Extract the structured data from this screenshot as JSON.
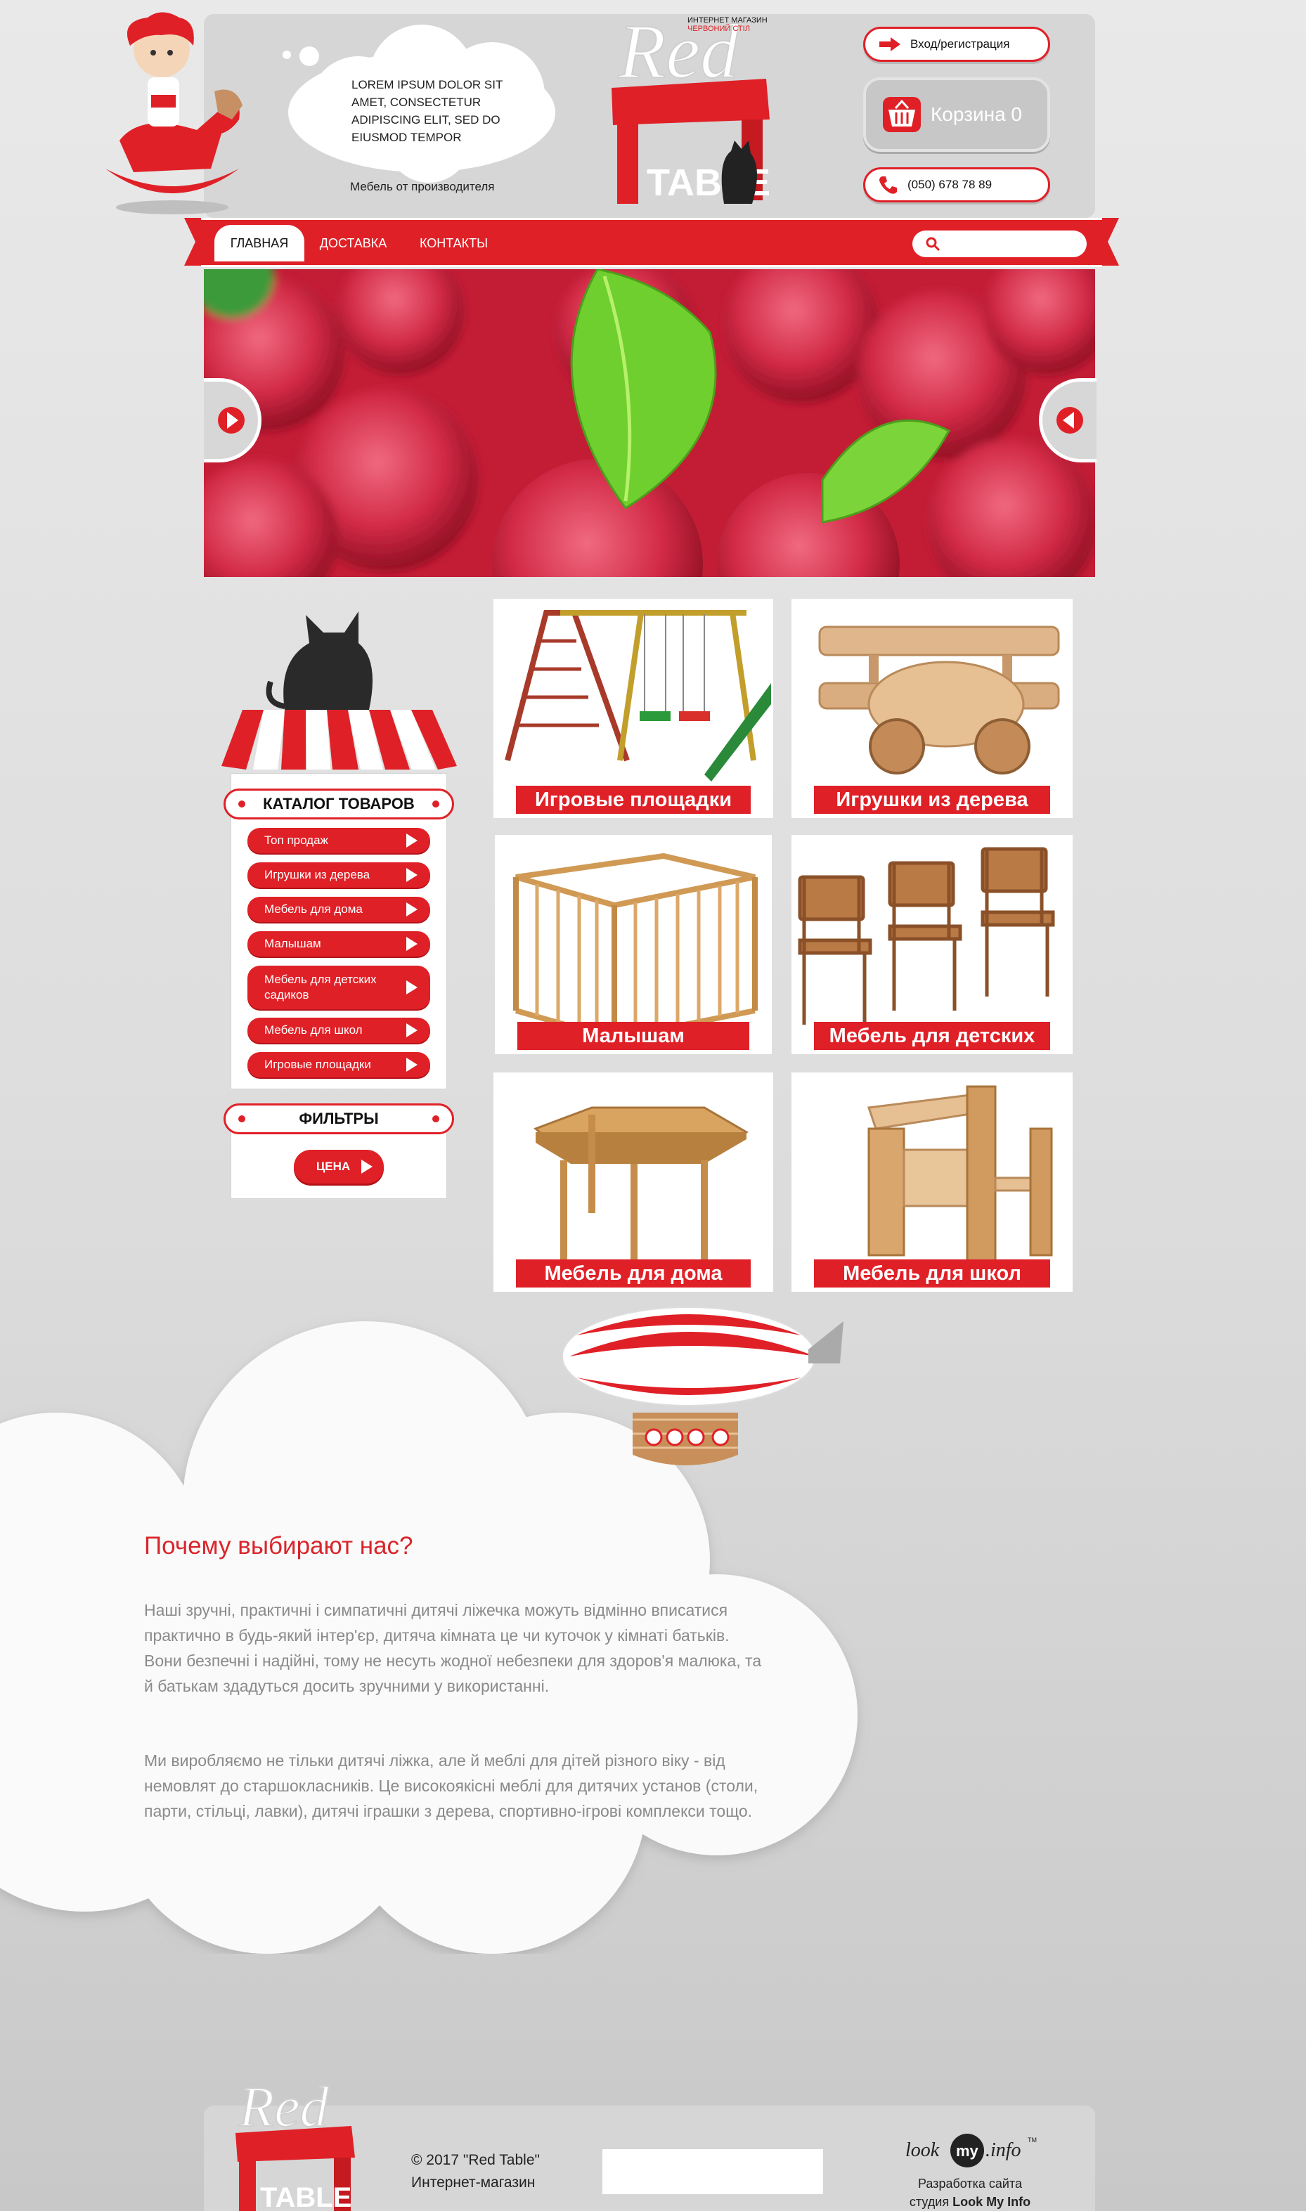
{
  "header": {
    "thought_text": "LOREM IPSUM DOLOR SIT AMET, CONSECTETUR ADIPISCING ELIT, SED DO EIUSMOD TEMPOR",
    "tagline": "Мебель от производителя",
    "logo_small_line1": "ИНТЕРНЕТ МАГАЗИН",
    "logo_small_line2": "ЧЕРВОНИЙ СТІЛ",
    "logo_red": "Red",
    "logo_table": "TABLE",
    "login_label": "Вход/регистрация",
    "cart_label": "Корзина 0",
    "phone_label": "(050) 678 78 89"
  },
  "nav": {
    "items": [
      {
        "label": "ГЛАВНАЯ"
      },
      {
        "label": "ДОСТАВКА"
      },
      {
        "label": "КОНТАКТЫ"
      }
    ],
    "search_placeholder": ""
  },
  "sidebar": {
    "catalog_title": "КАТАЛОГ ТОВАРОВ",
    "items": [
      {
        "label": "Топ продаж"
      },
      {
        "label": "Игрушки из дерева"
      },
      {
        "label": "Мебель для дома"
      },
      {
        "label": "Малышам"
      },
      {
        "label": "Мебель для детских садиков"
      },
      {
        "label": "Мебель для школ"
      },
      {
        "label": "Игровые площадки"
      }
    ],
    "filters_title": "ФИЛЬТРЫ",
    "price_label": "ЦЕНА"
  },
  "products": [
    {
      "label": "Игровые площадки"
    },
    {
      "label": "Игрушки из дерева"
    },
    {
      "label": "Малышам"
    },
    {
      "label": "Мебель для детских"
    },
    {
      "label": "Мебель для дома"
    },
    {
      "label": "Мебель для школ"
    }
  ],
  "about": {
    "title": "Почему выбирают нас?",
    "p1": "Наші зручні, практичні і симпатичні дитячі ліжечка можуть відмінно вписатися практично в будь-який інтер'єр, дитяча кімната це чи куточок у кімнаті батьків. Вони безпечні і надійні, тому не несуть жодної небезпеки для здоров'я малюка, та й батькам здадуться досить зручними у використанні.",
    "p2": "Ми виробляємо не тільки дитячі ліжка, але й меблі для дітей різного віку - від немовлят до старшокласників. Це високоякісні меблі для дитячих установ (столи, парти, стільці, лавки), дитячі іграшки з дерева, спортивно-ігрові комплекси тощо."
  },
  "footer": {
    "copyright": "© 2017 \"Red Table\"",
    "shop": "Интернет-магазин",
    "logo_red": "Red",
    "logo_table": "TABLE",
    "lmi_look": "look",
    "lmi_my": "my",
    "lmi_info": ".info",
    "lmi_tm": "TM",
    "dev_line1": "Разработка сайта",
    "dev_line2_prefix": "студия",
    "dev_line2_name": "Look My Info"
  },
  "colors": {
    "accent": "#e02027",
    "panel": "#d6d6d6",
    "about_title": "#d9252b"
  }
}
